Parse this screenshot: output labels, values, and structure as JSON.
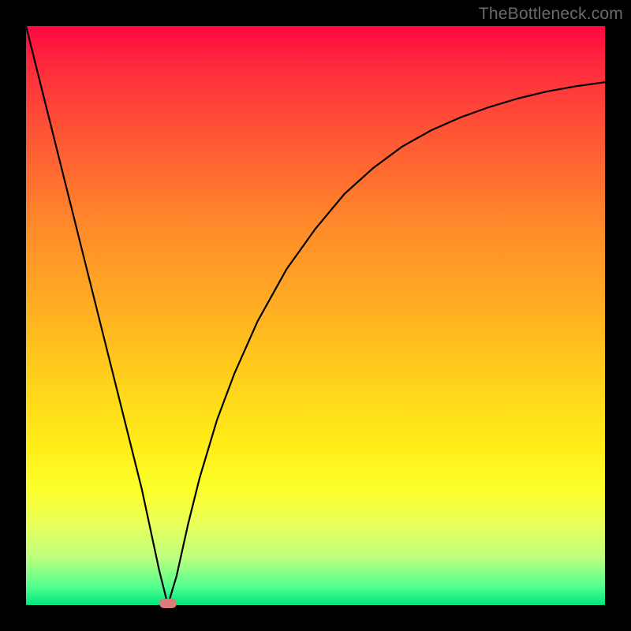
{
  "watermark": "TheBottleneck.com",
  "chart_data": {
    "type": "line",
    "title": "",
    "xlabel": "",
    "ylabel": "",
    "xlim": [
      0,
      100
    ],
    "ylim": [
      0,
      100
    ],
    "grid": false,
    "series": [
      {
        "name": "bottleneck-curve",
        "x": [
          0,
          5,
          10,
          15,
          20,
          23,
          24.5,
          26,
          28,
          30,
          33,
          36,
          40,
          45,
          50,
          55,
          60,
          65,
          70,
          75,
          80,
          85,
          90,
          95,
          100
        ],
        "values": [
          100,
          80,
          60,
          40,
          20,
          6,
          0,
          5,
          14,
          22,
          32,
          40,
          49,
          58,
          65,
          71,
          75.5,
          79.2,
          82,
          84.2,
          86,
          87.5,
          88.7,
          89.6,
          90.3
        ]
      }
    ],
    "annotations": [
      {
        "name": "min-marker",
        "x": 24.5,
        "y": 0,
        "color": "#da7c78"
      }
    ],
    "background_gradient": {
      "top": "#ff0740",
      "bottom": "#00e57a"
    }
  }
}
